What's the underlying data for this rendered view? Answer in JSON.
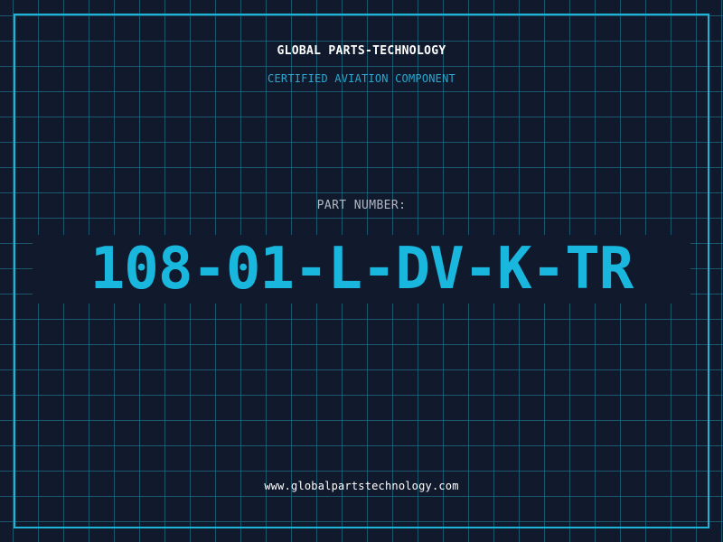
{
  "header": {
    "brand": "GLOBAL PARTS-TECHNOLOGY",
    "tagline": "CERTIFIED AVIATION COMPONENT"
  },
  "part": {
    "label": "PART NUMBER:",
    "number": "108-01-L-DV-K-TR"
  },
  "footer": {
    "website": "www.globalpartstechnology.com"
  },
  "colors": {
    "background": "#111a2d",
    "grid": "#1f6982",
    "frame": "#1eb4d8",
    "accent": "#19b6de",
    "tagline": "#2aa6cf",
    "label": "#b0b8c4",
    "text": "#ffffff"
  }
}
